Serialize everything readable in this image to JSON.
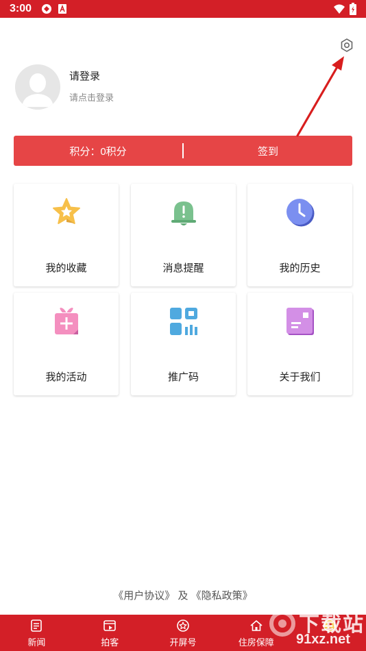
{
  "status_bar": {
    "time": "3:00"
  },
  "profile": {
    "title": "请登录",
    "subtitle": "请点击登录"
  },
  "points_bar": {
    "points_label": "积分：0积分",
    "checkin_label": "签到"
  },
  "menu": [
    {
      "label": "我的收藏",
      "icon": "star-icon",
      "color": "#f7c04a"
    },
    {
      "label": "消息提醒",
      "icon": "bell-icon",
      "color": "#7ac18e"
    },
    {
      "label": "我的历史",
      "icon": "clock-icon",
      "color": "#7b8ff0"
    },
    {
      "label": "我的活动",
      "icon": "gift-icon",
      "color": "#f48fbf"
    },
    {
      "label": "推广码",
      "icon": "qrcode-icon",
      "color": "#4fa9df"
    },
    {
      "label": "关于我们",
      "icon": "info-card-icon",
      "color": "#c77fe0"
    }
  ],
  "footer": {
    "user_agreement": "《用户协议》",
    "and_text": "及",
    "privacy_policy": "《隐私政策》"
  },
  "tabs": [
    {
      "label": "新闻",
      "icon": "news-icon"
    },
    {
      "label": "拍客",
      "icon": "photo-icon"
    },
    {
      "label": "开屏号",
      "icon": "star-circle-icon"
    },
    {
      "label": "住房保障",
      "icon": "house-icon"
    },
    {
      "label": "",
      "icon": "person-icon"
    }
  ],
  "watermark": {
    "text1": "下载站",
    "text2": "91xz.net"
  },
  "colors": {
    "brand_red": "#d31f27",
    "points_red": "#e64546"
  }
}
